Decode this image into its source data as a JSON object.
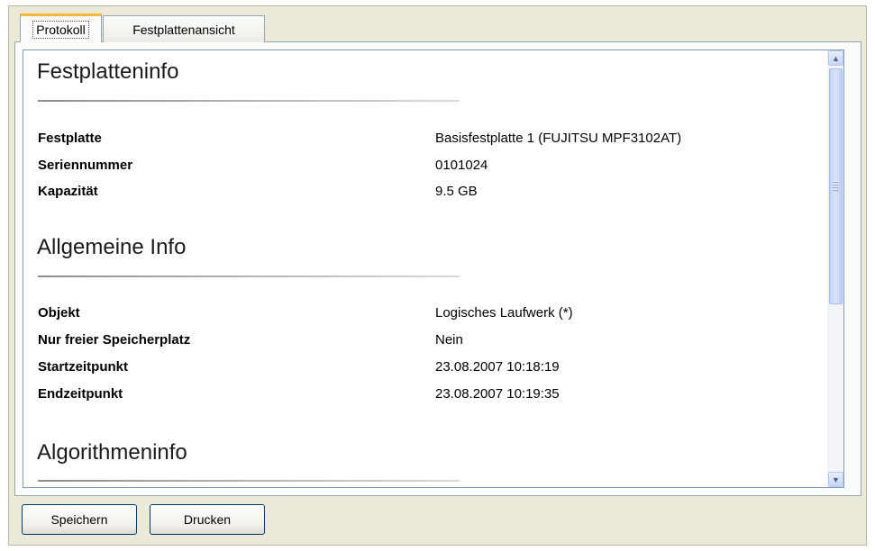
{
  "tabs": [
    {
      "label": "Protokoll"
    },
    {
      "label": "Festplattenansicht"
    }
  ],
  "sections": [
    {
      "title": "Festplatteninfo",
      "rows": [
        {
          "label": "Festplatte",
          "value": "Basisfestplatte 1 (FUJITSU MPF3102AT)"
        },
        {
          "label": "Seriennummer",
          "value": "0101024"
        },
        {
          "label": "Kapazität",
          "value": "9.5 GB"
        }
      ]
    },
    {
      "title": "Allgemeine Info",
      "rows": [
        {
          "label": "Objekt",
          "value": "Logisches Laufwerk (*)"
        },
        {
          "label": "Nur freier Speicherplatz",
          "value": "Nein"
        },
        {
          "label": "Startzeitpunkt",
          "value": "23.08.2007 10:18:19"
        },
        {
          "label": "Endzeitpunkt",
          "value": "23.08.2007 10:19:35"
        }
      ]
    },
    {
      "title": "Algorithmeninfo",
      "rows": []
    }
  ],
  "buttons": {
    "save_label": "Speichern",
    "print_label": "Drucken"
  },
  "icons": {
    "scroll_up": "chevron-up-icon",
    "scroll_down": "chevron-down-icon"
  },
  "colors": {
    "tab_highlight": "#f2b93b",
    "button_border": "#003c74",
    "scrollbar_thumb": "#c6d4f7"
  }
}
